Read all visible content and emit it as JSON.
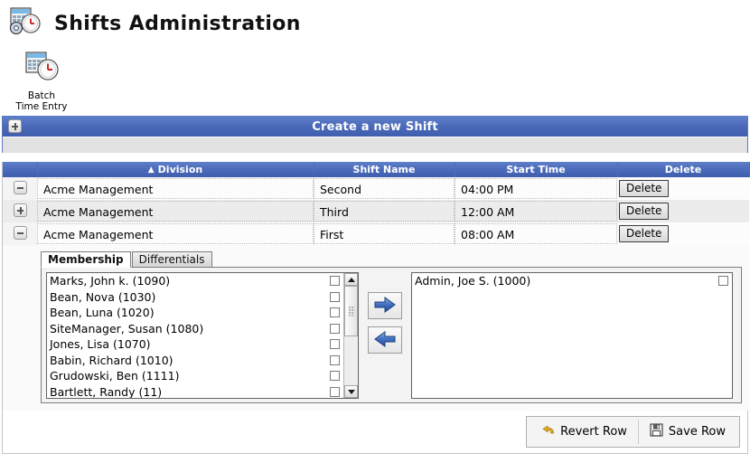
{
  "header": {
    "title": "Shifts Administration",
    "icon": "calendar-clock-gear-icon"
  },
  "toolbar": {
    "items": [
      {
        "label": "Batch\nTime Entry",
        "icon": "calendar-clock-icon"
      }
    ]
  },
  "create_panel": {
    "title": "Create a new Shift",
    "expander_icon": "plus-icon"
  },
  "grid": {
    "columns": [
      {
        "label": "Division",
        "sort": "asc",
        "sort_icon": "triangle-up-icon"
      },
      {
        "label": "Shift Name",
        "sort": "none"
      },
      {
        "label": "Start Time",
        "sort": "none"
      },
      {
        "label": "Delete",
        "sort": "none"
      }
    ],
    "rows": [
      {
        "expander_icon": "minus-icon",
        "division": "Acme Management",
        "shift_name": "Second",
        "start_time": "04:00 PM",
        "delete_label": "Delete"
      },
      {
        "expander_icon": "plus-icon",
        "division": "Acme Management",
        "shift_name": "Third",
        "start_time": "12:00 AM",
        "delete_label": "Delete"
      },
      {
        "expander_icon": "minus-icon",
        "division": "Acme Management",
        "shift_name": "First",
        "start_time": "08:00 AM",
        "delete_label": "Delete"
      }
    ]
  },
  "detail": {
    "tabs": [
      {
        "label": "Membership",
        "active": true
      },
      {
        "label": "Differentials",
        "active": false
      }
    ],
    "available_list": {
      "items": [
        "Marks, John k. (1090)",
        "Bean, Nova (1030)",
        "Bean, Luna (1020)",
        "SiteManager, Susan (1080)",
        "Jones, Lisa (1070)",
        "Babin, Richard (1010)",
        "Grudowski, Ben (1111)",
        "Bartlett, Randy (11)"
      ]
    },
    "assigned_list": {
      "items": [
        "Admin, Joe S. (1000)"
      ]
    },
    "transfer": {
      "add_icon": "arrow-right-icon",
      "remove_icon": "arrow-left-icon"
    }
  },
  "footer": {
    "revert_label": "Revert Row",
    "revert_icon": "undo-icon",
    "save_label": "Save Row",
    "save_icon": "floppy-disk-icon"
  },
  "colors": {
    "header_blue": "#4a69b8",
    "header_blue_light": "#5e7fc9",
    "row_alt": "#ececec",
    "arrow_blue": "#3f6fc0"
  }
}
